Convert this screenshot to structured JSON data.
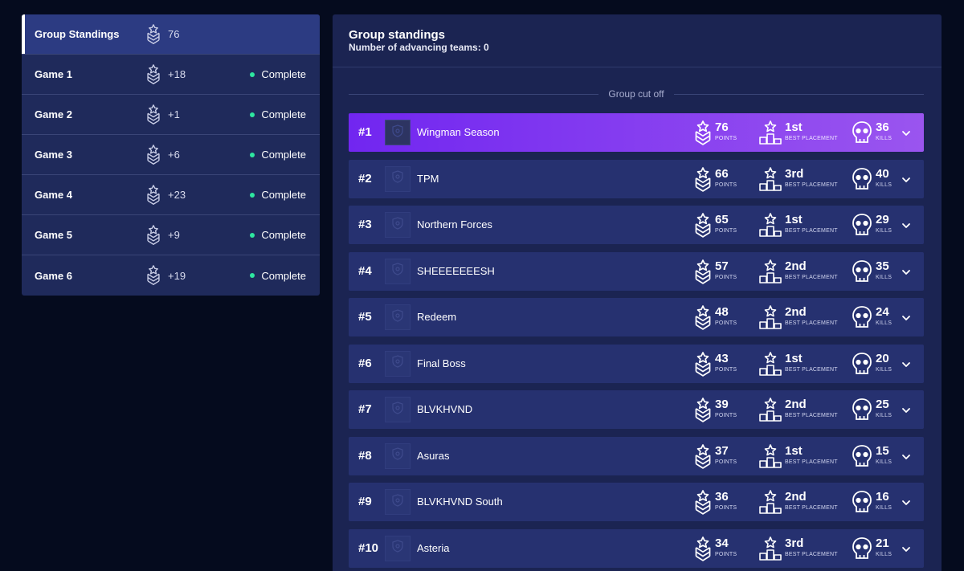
{
  "sidebar": {
    "items": [
      {
        "name": "Group Standings",
        "points": "76",
        "status": "",
        "active": true
      },
      {
        "name": "Game 1",
        "points": "+18",
        "status": "Complete"
      },
      {
        "name": "Game 2",
        "points": "+1",
        "status": "Complete"
      },
      {
        "name": "Game 3",
        "points": "+6",
        "status": "Complete"
      },
      {
        "name": "Game 4",
        "points": "+23",
        "status": "Complete"
      },
      {
        "name": "Game 5",
        "points": "+9",
        "status": "Complete"
      },
      {
        "name": "Game 6",
        "points": "+19",
        "status": "Complete"
      }
    ]
  },
  "panel": {
    "title": "Group standings",
    "subtitle": "Number of advancing teams: 0",
    "cutoff_label": "Group cut off"
  },
  "stat_labels": {
    "points": "POINTS",
    "placement": "BEST PLACEMENT",
    "kills": "KILLS"
  },
  "teams": [
    {
      "rank": "#1",
      "name": "Wingman Season",
      "points": "76",
      "placement": "1st",
      "kills": "36"
    },
    {
      "rank": "#2",
      "name": "TPM",
      "points": "66",
      "placement": "3rd",
      "kills": "40"
    },
    {
      "rank": "#3",
      "name": "Northern Forces",
      "points": "65",
      "placement": "1st",
      "kills": "29"
    },
    {
      "rank": "#4",
      "name": "SHEEEEEEESH",
      "points": "57",
      "placement": "2nd",
      "kills": "35"
    },
    {
      "rank": "#5",
      "name": "Redeem",
      "points": "48",
      "placement": "2nd",
      "kills": "24"
    },
    {
      "rank": "#6",
      "name": "Final Boss",
      "points": "43",
      "placement": "1st",
      "kills": "20"
    },
    {
      "rank": "#7",
      "name": "BLVKHVND",
      "points": "39",
      "placement": "2nd",
      "kills": "25"
    },
    {
      "rank": "#8",
      "name": "Asuras",
      "points": "37",
      "placement": "1st",
      "kills": "15"
    },
    {
      "rank": "#9",
      "name": "BLVKHVND South",
      "points": "36",
      "placement": "2nd",
      "kills": "16"
    },
    {
      "rank": "#10",
      "name": "Asteria",
      "points": "34",
      "placement": "3rd",
      "kills": "21"
    }
  ],
  "colors": {
    "accent_start": "#7126f0",
    "accent_end": "#9a55ef",
    "complete_dot": "#2ee6a0"
  },
  "icons": {
    "points": "chevron-rank-icon",
    "placement": "podium-icon",
    "kills": "skull-icon",
    "expand": "chevron-down-icon",
    "team": "shield-logo-icon"
  }
}
